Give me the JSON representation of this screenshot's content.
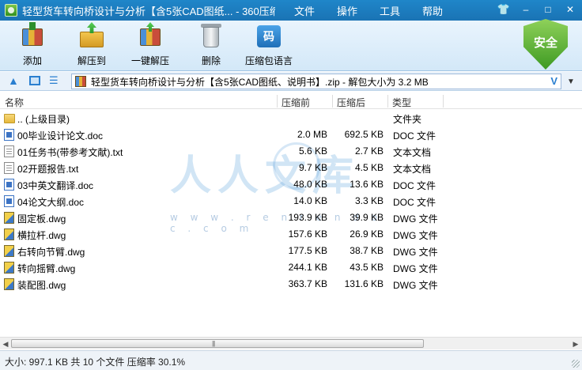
{
  "window": {
    "title": "轻型货车转向桥设计与分析【含5张CAD图纸... - 360压缩",
    "menu": [
      "文件",
      "操作",
      "工具",
      "帮助"
    ],
    "controls": {
      "skin": "👕",
      "minimize": "–",
      "maximize": "□",
      "close": "✕"
    }
  },
  "toolbar": {
    "add": "添加",
    "extract": "解压到",
    "one_click": "一键解压",
    "delete": "删除",
    "language": "压缩包语言",
    "language_glyph": "码",
    "security": "安全"
  },
  "address": {
    "text": "轻型货车转向桥设计与分析【含5张CAD图纸、说明书】.zip - 解包大小为 3.2 MB",
    "v_mark": "V",
    "dropdown": "▼"
  },
  "columns": {
    "name": "名称",
    "size": "压缩前",
    "packed": "压缩后",
    "type": "类型"
  },
  "files": [
    {
      "icon": "folder-icon",
      "kind": "folder",
      "name": ".. (上级目录)",
      "size": "",
      "packed": "",
      "type": "文件夹"
    },
    {
      "icon": "doc-icon",
      "kind": "doc",
      "name": "00毕业设计论文.doc",
      "size": "2.0 MB",
      "packed": "692.5 KB",
      "type": "DOC 文件"
    },
    {
      "icon": "txt-icon",
      "kind": "txt",
      "name": "01任务书(带参考文献).txt",
      "size": "5.6 KB",
      "packed": "2.7 KB",
      "type": "文本文档"
    },
    {
      "icon": "txt-icon",
      "kind": "txt",
      "name": "02开题报告.txt",
      "size": "9.7 KB",
      "packed": "4.5 KB",
      "type": "文本文档"
    },
    {
      "icon": "doc-icon",
      "kind": "doc",
      "name": "03中英文翻译.doc",
      "size": "48.0 KB",
      "packed": "13.6 KB",
      "type": "DOC 文件"
    },
    {
      "icon": "doc-icon",
      "kind": "doc",
      "name": "04论文大纲.doc",
      "size": "14.0 KB",
      "packed": "3.3 KB",
      "type": "DOC 文件"
    },
    {
      "icon": "dwg-icon",
      "kind": "dwg",
      "name": "固定板.dwg",
      "size": "193.9 KB",
      "packed": "39.9 KB",
      "type": "DWG 文件"
    },
    {
      "icon": "dwg-icon",
      "kind": "dwg",
      "name": "横拉杆.dwg",
      "size": "157.6 KB",
      "packed": "26.9 KB",
      "type": "DWG 文件"
    },
    {
      "icon": "dwg-icon",
      "kind": "dwg",
      "name": "右转向节臂.dwg",
      "size": "177.5 KB",
      "packed": "38.7 KB",
      "type": "DWG 文件"
    },
    {
      "icon": "dwg-icon",
      "kind": "dwg",
      "name": "转向摇臂.dwg",
      "size": "244.1 KB",
      "packed": "43.5 KB",
      "type": "DWG 文件"
    },
    {
      "icon": "dwg-icon",
      "kind": "dwg",
      "name": "装配图.dwg",
      "size": "363.7 KB",
      "packed": "131.6 KB",
      "type": "DWG 文件"
    }
  ],
  "watermark": {
    "big": "人人文库",
    "url": "w w w . r e n r e n d o c . c o m"
  },
  "scrollbar": {
    "left": "◀",
    "right": "▶",
    "grip": "|||"
  },
  "status": {
    "text": "大小: 997.1 KB 共 10 个文件 压缩率 30.1%"
  },
  "colors": {
    "titlebar": "#1a73b4",
    "toolbar": "#d3e8f8",
    "shield": "#3e9a23"
  }
}
